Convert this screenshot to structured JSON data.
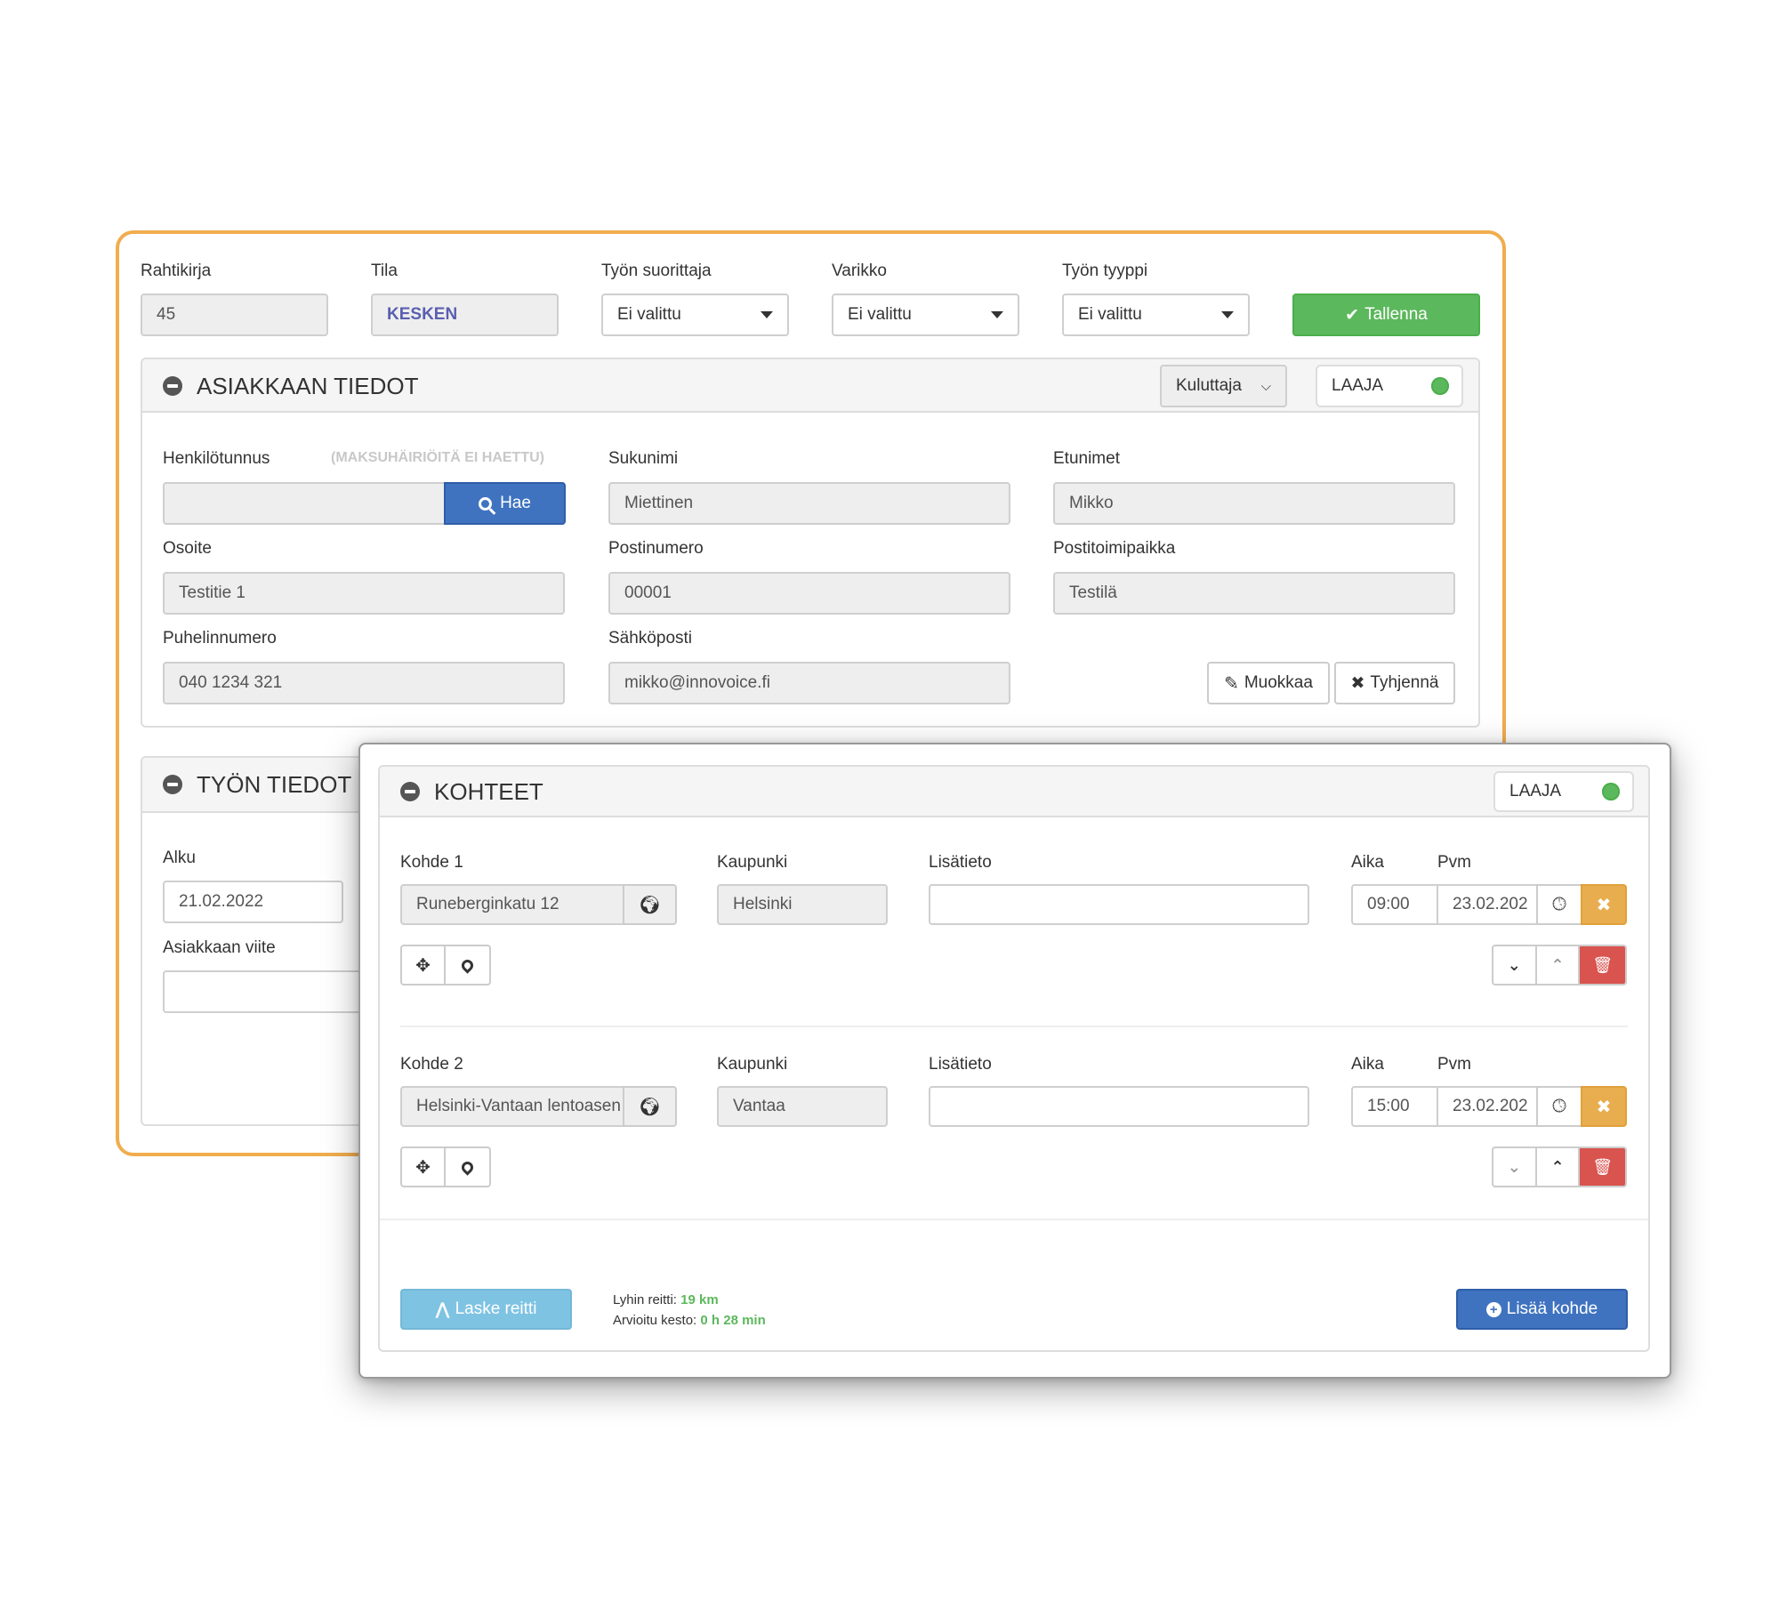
{
  "colors": {
    "frame_border": "#f0ad4e",
    "save": "#5cb85c",
    "primary": "#3f73c0",
    "info": "#7fc3e3",
    "warning": "#e8ad4e",
    "danger": "#d9534f",
    "ok_text": "#5cb85c"
  },
  "top": {
    "rahtikirja": {
      "label": "Rahtikirja",
      "value": "45"
    },
    "tila": {
      "label": "Tila",
      "value": "KESKEN"
    },
    "suorittaja": {
      "label": "Työn suorittaja",
      "value": "Ei valittu"
    },
    "varikko": {
      "label": "Varikko",
      "value": "Ei valittu"
    },
    "tyyppi": {
      "label": "Työn tyyppi",
      "value": "Ei valittu"
    },
    "save_label": "Tallenna"
  },
  "customer": {
    "title": "ASIAKKAAN TIEDOT",
    "type_select": "Kuluttaja",
    "toggle_label": "LAAJA",
    "hetu": {
      "label": "Henkilötunnus",
      "note": "(MAKSUHÄIRIÖITÄ EI HAETTU)",
      "value": "",
      "search_label": "Hae"
    },
    "sukunimi": {
      "label": "Sukunimi",
      "value": "Miettinen"
    },
    "etunimet": {
      "label": "Etunimet",
      "value": "Mikko"
    },
    "osoite": {
      "label": "Osoite",
      "value": "Testitie 1"
    },
    "postinumero": {
      "label": "Postinumero",
      "value": "00001"
    },
    "postitoimipaikka": {
      "label": "Postitoimipaikka",
      "value": "Testilä"
    },
    "puhelin": {
      "label": "Puhelinnumero",
      "value": "040 1234 321"
    },
    "email": {
      "label": "Sähköposti",
      "value": "mikko@innovoice.fi"
    },
    "edit_label": "Muokkaa",
    "clear_label": "Tyhjennä"
  },
  "work": {
    "title": "TYÖN TIEDOT",
    "alku": {
      "label": "Alku",
      "value": "21.02.2022"
    },
    "viite": {
      "label": "Asiakkaan viite",
      "value": ""
    }
  },
  "targets": {
    "title": "KOHTEET",
    "toggle_label": "LAAJA",
    "kaupunki_label": "Kaupunki",
    "lisatieto_label": "Lisätieto",
    "aika_label": "Aika",
    "pvm_label": "Pvm",
    "items": [
      {
        "label": "Kohde 1",
        "address": "Runeberginkatu 12",
        "city": "Helsinki",
        "info": "",
        "time": "09:00",
        "date": "23.02.202"
      },
      {
        "label": "Kohde 2",
        "address": "Helsinki-Vantaan lentoasen",
        "city": "Vantaa",
        "info": "",
        "time": "15:00",
        "date": "23.02.202"
      }
    ],
    "route_button": "Laske reitti",
    "route_label": "Lyhin reitti:",
    "route_value": "19 km",
    "duration_label": "Arvioitu kesto:",
    "duration_value": "0 h 28 min",
    "add_button": "Lisää kohde"
  }
}
